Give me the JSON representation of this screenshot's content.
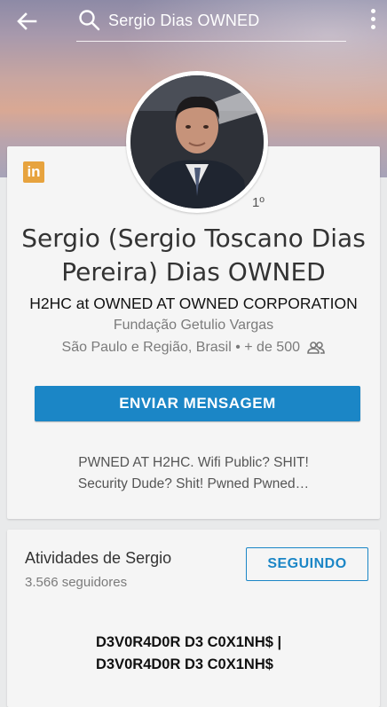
{
  "topbar": {
    "search_value": "Sergio Dias OWNED"
  },
  "profile": {
    "network_badge": "in",
    "degree": "1º",
    "name": "Sergio (Sergio Toscano Dias Pereira) Dias OWNED",
    "headline": "H2HC at OWNED AT OWNED CORPORATION",
    "school": "Fundação Getulio Vargas",
    "location": "São Paulo e Região, Brasil • + de 500",
    "cta_label": "ENVIAR MENSAGEM",
    "summary_line1": "PWNED AT H2HC. Wifi Public? SHIT!",
    "summary_line2": "Security Dude? Shit! Pwned Pwned…"
  },
  "activity": {
    "title": "Atividades de Sergio",
    "followers": "3.566 seguidores",
    "follow_button": "SEGUINDO",
    "post_title_line1": "D3V0R4D0R D3 C0X1NH$ |",
    "post_title_line2": "D3V0R4D0R D3 C0X1NH$"
  },
  "colors": {
    "accent": "#1b86c6",
    "linkedin_badge": "#e7a33e"
  },
  "icons": [
    "back-arrow-icon",
    "search-icon",
    "more-vert-icon",
    "linkedin-icon",
    "connections-icon"
  ]
}
